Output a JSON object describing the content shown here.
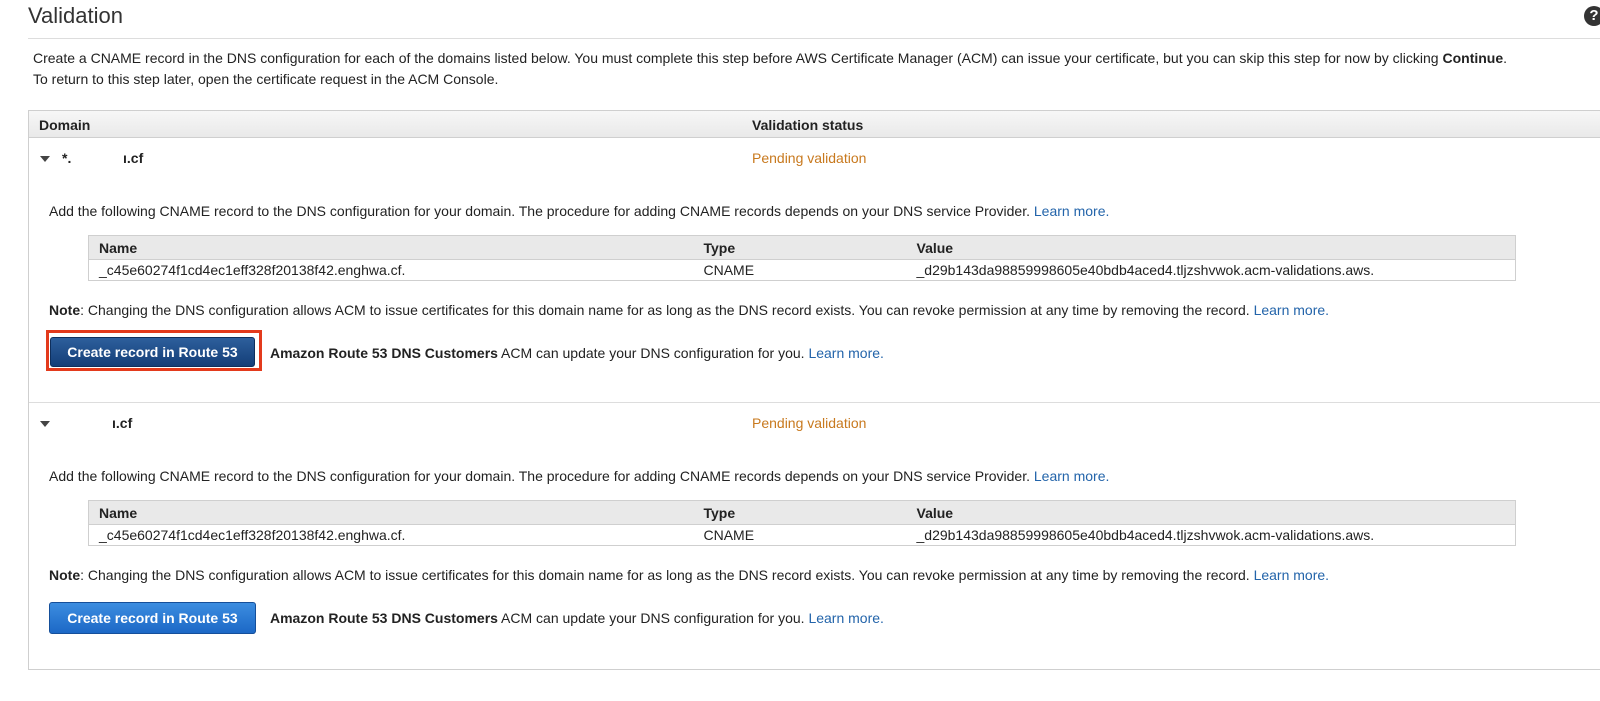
{
  "page": {
    "title": "Validation",
    "help_icon": "question-circle-icon",
    "intro_text": "Create a CNAME record in the DNS configuration for each of the domains listed below. You must complete this step before AWS Certificate Manager (ACM) can issue your certificate, but you can skip this step for now by clicking ",
    "intro_bold": "Continue",
    "intro_end": ".",
    "intro_line2": "To return to this step later, open the certificate request in the ACM Console."
  },
  "table": {
    "headers": {
      "domain": "Domain",
      "status": "Validation status"
    },
    "domains": [
      {
        "name_prefix": "*.",
        "name_suffix": "ı.cf",
        "status": "Pending validation",
        "instructions": "Add the following CNAME record to the DNS configuration for your domain. The procedure for adding CNAME records depends on your DNS service Provider. ",
        "instructions_link": "Learn more.",
        "cname_headers": {
          "name": "Name",
          "type": "Type",
          "value": "Value"
        },
        "cname_row": {
          "name": "_c45e60274f1cd4ec1eff328f20138f42.enghwa.cf.",
          "type": "CNAME",
          "value": "_d29b143da98859998605e40bdb4aced4.tljzshvwok.acm-validations.aws."
        },
        "note_label": "Note",
        "note_text": ": Changing the DNS configuration allows ACM to issue certificates for this domain name for as long as the DNS record exists. You can revoke permission at any time by removing the record. ",
        "note_link": "Learn more.",
        "button_label": "Create record in Route 53",
        "route_bold": "Amazon Route 53 DNS Customers",
        "route_text": " ACM can update your DNS configuration for you. ",
        "route_link": "Learn more."
      },
      {
        "name_prefix": "",
        "name_suffix": "ı.cf",
        "status": "Pending validation",
        "instructions": "Add the following CNAME record to the DNS configuration for your domain. The procedure for adding CNAME records depends on your DNS service Provider. ",
        "instructions_link": "Learn more.",
        "cname_headers": {
          "name": "Name",
          "type": "Type",
          "value": "Value"
        },
        "cname_row": {
          "name": "_c45e60274f1cd4ec1eff328f20138f42.enghwa.cf.",
          "type": "CNAME",
          "value": "_d29b143da98859998605e40bdb4aced4.tljzshvwok.acm-validations.aws."
        },
        "note_label": "Note",
        "note_text": ": Changing the DNS configuration allows ACM to issue certificates for this domain name for as long as the DNS record exists. You can revoke permission at any time by removing the record. ",
        "note_link": "Learn more.",
        "button_label": "Create record in Route 53",
        "route_bold": "Amazon Route 53 DNS Customers",
        "route_text": " ACM can update your DNS configuration for you. ",
        "route_link": "Learn more."
      }
    ]
  },
  "colors": {
    "pending": "#c8791e",
    "link": "#2364aa",
    "highlight": "#e33a1c",
    "button": "#1c68c6"
  }
}
